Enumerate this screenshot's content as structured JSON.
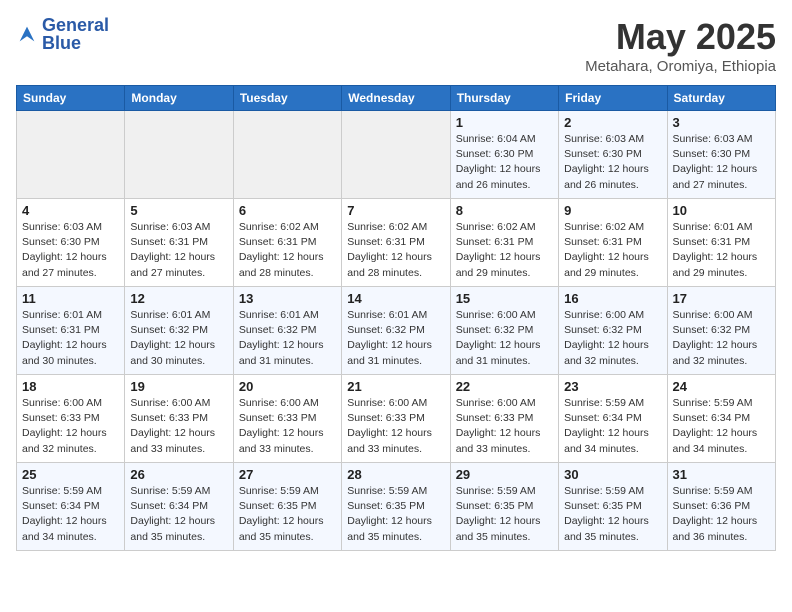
{
  "header": {
    "logo_line1": "General",
    "logo_line2": "Blue",
    "month": "May 2025",
    "location": "Metahara, Oromiya, Ethiopia"
  },
  "days_of_week": [
    "Sunday",
    "Monday",
    "Tuesday",
    "Wednesday",
    "Thursday",
    "Friday",
    "Saturday"
  ],
  "weeks": [
    [
      {
        "day": "",
        "empty": true
      },
      {
        "day": "",
        "empty": true
      },
      {
        "day": "",
        "empty": true
      },
      {
        "day": "",
        "empty": true
      },
      {
        "day": "1",
        "sunrise": "6:04 AM",
        "sunset": "6:30 PM",
        "daylight": "12 hours and 26 minutes."
      },
      {
        "day": "2",
        "sunrise": "6:03 AM",
        "sunset": "6:30 PM",
        "daylight": "12 hours and 26 minutes."
      },
      {
        "day": "3",
        "sunrise": "6:03 AM",
        "sunset": "6:30 PM",
        "daylight": "12 hours and 27 minutes."
      }
    ],
    [
      {
        "day": "4",
        "sunrise": "6:03 AM",
        "sunset": "6:30 PM",
        "daylight": "12 hours and 27 minutes."
      },
      {
        "day": "5",
        "sunrise": "6:03 AM",
        "sunset": "6:31 PM",
        "daylight": "12 hours and 27 minutes."
      },
      {
        "day": "6",
        "sunrise": "6:02 AM",
        "sunset": "6:31 PM",
        "daylight": "12 hours and 28 minutes."
      },
      {
        "day": "7",
        "sunrise": "6:02 AM",
        "sunset": "6:31 PM",
        "daylight": "12 hours and 28 minutes."
      },
      {
        "day": "8",
        "sunrise": "6:02 AM",
        "sunset": "6:31 PM",
        "daylight": "12 hours and 29 minutes."
      },
      {
        "day": "9",
        "sunrise": "6:02 AM",
        "sunset": "6:31 PM",
        "daylight": "12 hours and 29 minutes."
      },
      {
        "day": "10",
        "sunrise": "6:01 AM",
        "sunset": "6:31 PM",
        "daylight": "12 hours and 29 minutes."
      }
    ],
    [
      {
        "day": "11",
        "sunrise": "6:01 AM",
        "sunset": "6:31 PM",
        "daylight": "12 hours and 30 minutes."
      },
      {
        "day": "12",
        "sunrise": "6:01 AM",
        "sunset": "6:32 PM",
        "daylight": "12 hours and 30 minutes."
      },
      {
        "day": "13",
        "sunrise": "6:01 AM",
        "sunset": "6:32 PM",
        "daylight": "12 hours and 31 minutes."
      },
      {
        "day": "14",
        "sunrise": "6:01 AM",
        "sunset": "6:32 PM",
        "daylight": "12 hours and 31 minutes."
      },
      {
        "day": "15",
        "sunrise": "6:00 AM",
        "sunset": "6:32 PM",
        "daylight": "12 hours and 31 minutes."
      },
      {
        "day": "16",
        "sunrise": "6:00 AM",
        "sunset": "6:32 PM",
        "daylight": "12 hours and 32 minutes."
      },
      {
        "day": "17",
        "sunrise": "6:00 AM",
        "sunset": "6:32 PM",
        "daylight": "12 hours and 32 minutes."
      }
    ],
    [
      {
        "day": "18",
        "sunrise": "6:00 AM",
        "sunset": "6:33 PM",
        "daylight": "12 hours and 32 minutes."
      },
      {
        "day": "19",
        "sunrise": "6:00 AM",
        "sunset": "6:33 PM",
        "daylight": "12 hours and 33 minutes."
      },
      {
        "day": "20",
        "sunrise": "6:00 AM",
        "sunset": "6:33 PM",
        "daylight": "12 hours and 33 minutes."
      },
      {
        "day": "21",
        "sunrise": "6:00 AM",
        "sunset": "6:33 PM",
        "daylight": "12 hours and 33 minutes."
      },
      {
        "day": "22",
        "sunrise": "6:00 AM",
        "sunset": "6:33 PM",
        "daylight": "12 hours and 33 minutes."
      },
      {
        "day": "23",
        "sunrise": "5:59 AM",
        "sunset": "6:34 PM",
        "daylight": "12 hours and 34 minutes."
      },
      {
        "day": "24",
        "sunrise": "5:59 AM",
        "sunset": "6:34 PM",
        "daylight": "12 hours and 34 minutes."
      }
    ],
    [
      {
        "day": "25",
        "sunrise": "5:59 AM",
        "sunset": "6:34 PM",
        "daylight": "12 hours and 34 minutes."
      },
      {
        "day": "26",
        "sunrise": "5:59 AM",
        "sunset": "6:34 PM",
        "daylight": "12 hours and 35 minutes."
      },
      {
        "day": "27",
        "sunrise": "5:59 AM",
        "sunset": "6:35 PM",
        "daylight": "12 hours and 35 minutes."
      },
      {
        "day": "28",
        "sunrise": "5:59 AM",
        "sunset": "6:35 PM",
        "daylight": "12 hours and 35 minutes."
      },
      {
        "day": "29",
        "sunrise": "5:59 AM",
        "sunset": "6:35 PM",
        "daylight": "12 hours and 35 minutes."
      },
      {
        "day": "30",
        "sunrise": "5:59 AM",
        "sunset": "6:35 PM",
        "daylight": "12 hours and 35 minutes."
      },
      {
        "day": "31",
        "sunrise": "5:59 AM",
        "sunset": "6:36 PM",
        "daylight": "12 hours and 36 minutes."
      }
    ]
  ]
}
